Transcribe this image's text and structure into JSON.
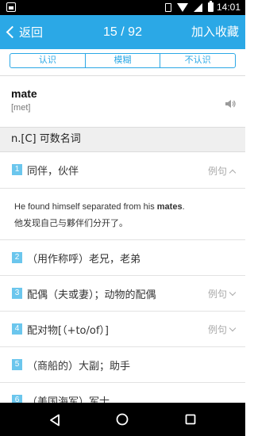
{
  "status_bar": {
    "time": "14:01"
  },
  "header": {
    "back_label": "返回",
    "counter": "15 / 92",
    "add_favorite": "加入收藏"
  },
  "segments": [
    "认识",
    "模糊",
    "不认识"
  ],
  "word": {
    "text": "mate",
    "phonetic": "[met]"
  },
  "part_of_speech": "n.[C] 可数名词",
  "definitions": [
    {
      "num": "1",
      "text": "同伴，伙伴",
      "example_label": "例句",
      "expanded": true
    },
    {
      "num": "2",
      "text": "（用作称呼）老兄，老弟",
      "example_label": ""
    },
    {
      "num": "3",
      "text": "配偶（夫或妻）；动物的配偶",
      "example_label": "例句"
    },
    {
      "num": "4",
      "text": "配对物[（+to/of）]",
      "example_label": "例句"
    },
    {
      "num": "5",
      "text": "（商船的）大副；助手",
      "example_label": ""
    },
    {
      "num": "6",
      "text": "（美国海军）军士",
      "example_label": ""
    }
  ],
  "example": {
    "en_before": "He found himself separated from his ",
    "en_bold": "mates",
    "en_after": ".",
    "zh": "他发现自己与夥伴们分开了。"
  }
}
